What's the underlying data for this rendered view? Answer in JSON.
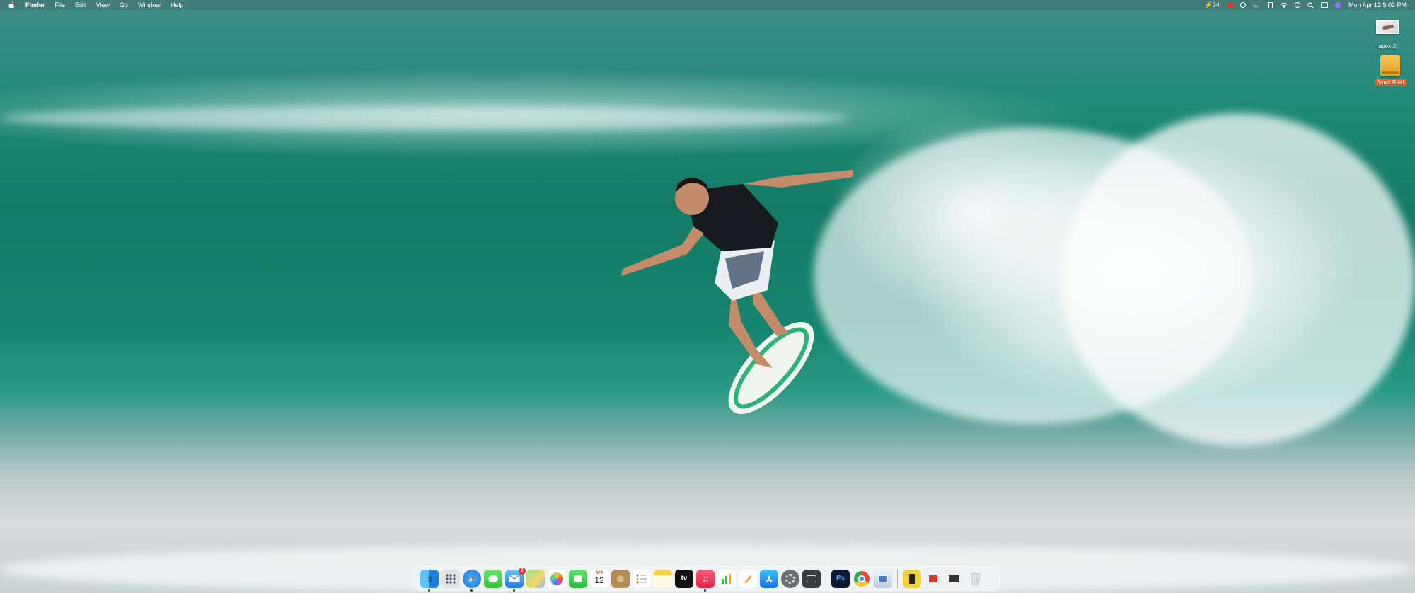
{
  "menubar": {
    "apple_icon": "apple-icon",
    "app_name": "Finder",
    "menus": [
      "File",
      "Edit",
      "View",
      "Go",
      "Window",
      "Help"
    ],
    "battery_text": "94",
    "datetime": "Mon Apr 12  5:02 PM"
  },
  "desktop": {
    "icons": [
      {
        "label": "apex-2",
        "icon": "image-file-icon",
        "selected": false
      },
      {
        "label": "Small Raid",
        "icon": "external-drive-icon",
        "selected": true
      }
    ]
  },
  "dock": {
    "apps": [
      {
        "name": "Finder",
        "icon": "finder-icon",
        "running": true
      },
      {
        "name": "Launchpad",
        "icon": "launchpad-icon",
        "running": false
      },
      {
        "name": "Safari",
        "icon": "safari-icon",
        "running": true
      },
      {
        "name": "Messages",
        "icon": "messages-icon",
        "running": false
      },
      {
        "name": "Mail",
        "icon": "mail-icon",
        "running": true,
        "badge": "2"
      },
      {
        "name": "Maps",
        "icon": "maps-icon",
        "running": false
      },
      {
        "name": "Photos",
        "icon": "photos-icon",
        "running": false
      },
      {
        "name": "FaceTime",
        "icon": "facetime-icon",
        "running": false
      },
      {
        "name": "Calendar",
        "icon": "calendar-icon",
        "running": false,
        "month": "APR",
        "day": "12"
      },
      {
        "name": "Contacts",
        "icon": "contacts-icon",
        "running": false
      },
      {
        "name": "Reminders",
        "icon": "reminders-icon",
        "running": false
      },
      {
        "name": "Notes",
        "icon": "notes-icon",
        "running": false
      },
      {
        "name": "TV",
        "icon": "apple-tv-icon",
        "running": false,
        "text": "tv"
      },
      {
        "name": "Music",
        "icon": "music-icon",
        "running": true
      },
      {
        "name": "Numbers",
        "icon": "numbers-icon",
        "running": false
      },
      {
        "name": "Pages",
        "icon": "pages-icon",
        "running": false
      },
      {
        "name": "App Store",
        "icon": "app-store-icon",
        "running": false
      },
      {
        "name": "System Preferences",
        "icon": "system-preferences-icon",
        "running": false
      },
      {
        "name": "Screenshot",
        "icon": "screenshot-icon",
        "running": false
      },
      {
        "name": "Photoshop",
        "icon": "photoshop-icon",
        "running": false,
        "text": "Ps"
      },
      {
        "name": "Chrome",
        "icon": "chrome-icon",
        "running": false
      },
      {
        "name": "Preview",
        "icon": "preview-icon",
        "running": false
      },
      {
        "name": "Notes Folder",
        "icon": "yellow-doc-icon",
        "running": false
      },
      {
        "name": "Downloads",
        "icon": "downloads-stack-icon",
        "running": false
      },
      {
        "name": "Documents",
        "icon": "documents-stack-icon",
        "running": false
      },
      {
        "name": "Trash",
        "icon": "trash-icon",
        "running": false
      }
    ]
  },
  "colors": {
    "menubar_bg": "#466e6e",
    "selection": "#e2662c",
    "badge": "#e0322c"
  }
}
